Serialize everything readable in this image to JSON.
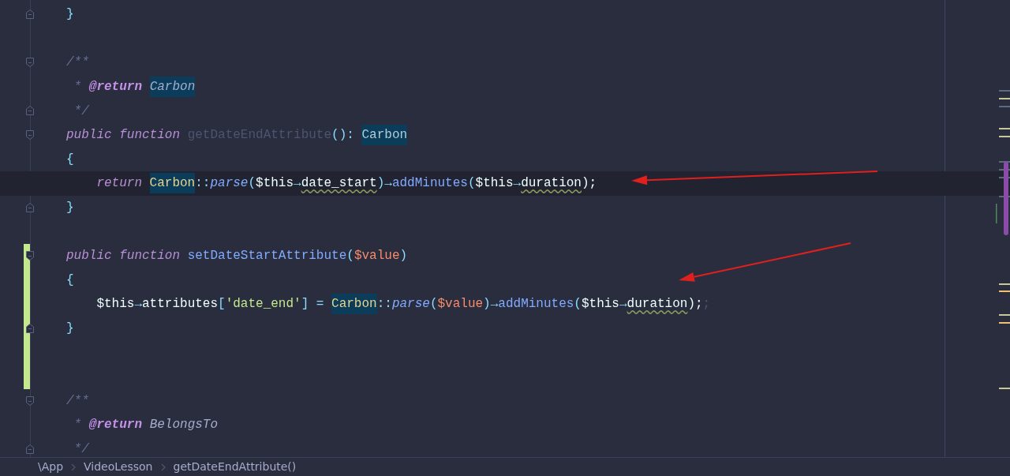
{
  "editor": {
    "lines": [
      {
        "kind": "code",
        "fold_end": true,
        "tokens": [
          {
            "text": "}",
            "kind": "punct"
          }
        ]
      },
      {
        "kind": "blank"
      },
      {
        "kind": "code",
        "fold_start": true,
        "tokens": [
          {
            "text": "/**",
            "kind": "comment"
          }
        ]
      },
      {
        "kind": "code",
        "tokens": [
          {
            "text": " * ",
            "kind": "comment"
          },
          {
            "text": "@return ",
            "kind": "doctag"
          },
          {
            "text": "Carbon",
            "kind": "doctype",
            "highlighted": true
          }
        ]
      },
      {
        "kind": "code",
        "fold_end": true,
        "tokens": [
          {
            "text": " */",
            "kind": "comment"
          }
        ]
      },
      {
        "kind": "code",
        "fold_start": true,
        "tokens": [
          {
            "text": "public function ",
            "kind": "keyword"
          },
          {
            "text": "getDateEndAttribute",
            "kind": "unused"
          },
          {
            "text": "(): ",
            "kind": "punct"
          },
          {
            "text": "Carbon",
            "kind": "type",
            "highlighted": true
          }
        ]
      },
      {
        "kind": "code",
        "tokens": [
          {
            "text": "{",
            "kind": "punct"
          }
        ]
      },
      {
        "kind": "code",
        "indented": true,
        "current": true,
        "arrow": true,
        "tokens": [
          {
            "text": "return ",
            "kind": "keyword"
          },
          {
            "text": "Carbon",
            "kind": "class",
            "highlighted": true
          },
          {
            "text": "::",
            "kind": "punct"
          },
          {
            "text": "parse",
            "kind": "static"
          },
          {
            "text": "(",
            "kind": "punct"
          },
          {
            "text": "$this",
            "kind": "text"
          },
          {
            "text": "→",
            "kind": "punct"
          },
          {
            "text": "date_start",
            "kind": "text",
            "underlined": true
          },
          {
            "text": ")",
            "kind": "punct"
          },
          {
            "text": "→",
            "kind": "punct"
          },
          {
            "text": "addMinutes",
            "kind": "method"
          },
          {
            "text": "(",
            "kind": "punct"
          },
          {
            "text": "$this",
            "kind": "text"
          },
          {
            "text": "→",
            "kind": "punct"
          },
          {
            "text": "duration",
            "kind": "text",
            "underlined": true
          },
          {
            "text": ");",
            "kind": "text"
          }
        ]
      },
      {
        "kind": "code",
        "fold_end": true,
        "tokens": [
          {
            "text": "}",
            "kind": "punct"
          }
        ]
      },
      {
        "kind": "blank"
      },
      {
        "kind": "code",
        "fold_start": true,
        "changed": true,
        "tokens": [
          {
            "text": "public function ",
            "kind": "keyword"
          },
          {
            "text": "setDateStartAttribute",
            "kind": "method"
          },
          {
            "text": "(",
            "kind": "punct"
          },
          {
            "text": "$value",
            "kind": "var"
          },
          {
            "text": ")",
            "kind": "punct"
          }
        ]
      },
      {
        "kind": "code",
        "changed": true,
        "arrow": true,
        "tokens": [
          {
            "text": "{",
            "kind": "punct"
          }
        ]
      },
      {
        "kind": "code",
        "indented": true,
        "changed": true,
        "tokens": [
          {
            "text": "$this",
            "kind": "text"
          },
          {
            "text": "→",
            "kind": "punct"
          },
          {
            "text": "attributes",
            "kind": "text"
          },
          {
            "text": "[",
            "kind": "punct"
          },
          {
            "text": "'date_end'",
            "kind": "string"
          },
          {
            "text": "] = ",
            "kind": "punct"
          },
          {
            "text": "Carbon",
            "kind": "class",
            "highlighted": true
          },
          {
            "text": "::",
            "kind": "punct"
          },
          {
            "text": "parse",
            "kind": "static"
          },
          {
            "text": "(",
            "kind": "punct"
          },
          {
            "text": "$value",
            "kind": "var"
          },
          {
            "text": ")",
            "kind": "punct"
          },
          {
            "text": "→",
            "kind": "punct"
          },
          {
            "text": "addMinutes",
            "kind": "method"
          },
          {
            "text": "(",
            "kind": "punct"
          },
          {
            "text": "$this",
            "kind": "text"
          },
          {
            "text": "→",
            "kind": "punct"
          },
          {
            "text": "duration",
            "kind": "text",
            "underlined": true
          },
          {
            "text": ");",
            "kind": "text"
          },
          {
            "text": ";",
            "kind": "unused"
          }
        ]
      },
      {
        "kind": "code",
        "fold_end": true,
        "changed": true,
        "tokens": [
          {
            "text": "}",
            "kind": "punct"
          }
        ]
      },
      {
        "kind": "blank",
        "changed": true
      },
      {
        "kind": "blank",
        "changed": true
      },
      {
        "kind": "code",
        "fold_start": true,
        "tokens": [
          {
            "text": "/**",
            "kind": "comment"
          }
        ]
      },
      {
        "kind": "code",
        "tokens": [
          {
            "text": " * ",
            "kind": "comment"
          },
          {
            "text": "@return ",
            "kind": "doctag"
          },
          {
            "text": "BelongsTo",
            "kind": "doctype"
          }
        ]
      },
      {
        "kind": "code",
        "fold_end": true,
        "tokens": [
          {
            "text": " */",
            "kind": "comment"
          }
        ]
      }
    ]
  },
  "breadcrumbs": [
    "\\App",
    "VideoLesson",
    "getDateEndAttribute()"
  ]
}
